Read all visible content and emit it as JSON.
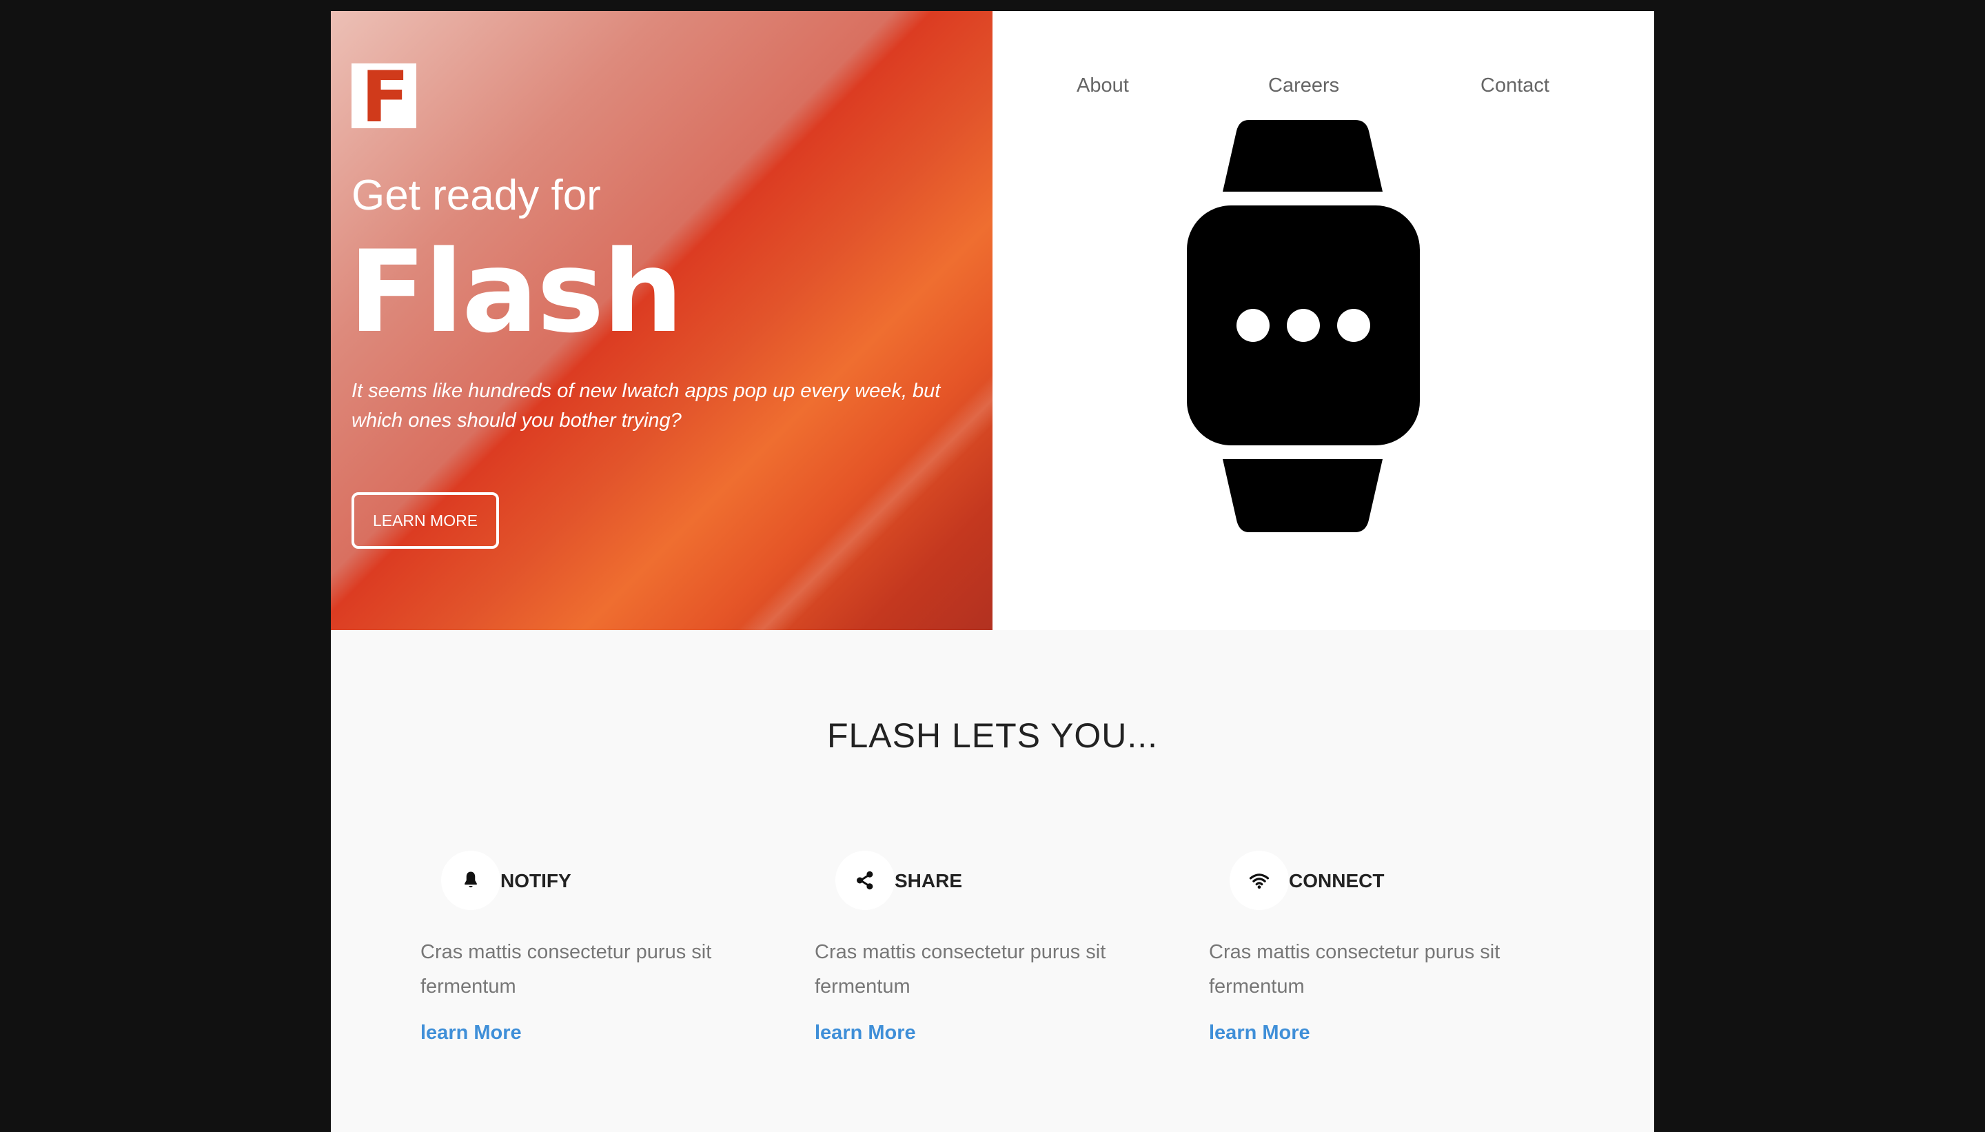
{
  "hero": {
    "logo_letter": "F",
    "pre_title": "Get ready for",
    "title": "Flash",
    "description": "It seems like hundreds of new Iwatch apps pop up every week, but which ones should you bother trying?",
    "cta_label": "LEARN MORE"
  },
  "nav": {
    "items": [
      {
        "label": "About"
      },
      {
        "label": "Careers"
      },
      {
        "label": "Contact"
      }
    ]
  },
  "features": {
    "title": "FLASH LETS YOU...",
    "items": [
      {
        "name": "NOTIFY",
        "icon": "bell-icon",
        "description": "Cras mattis consectetur purus sit fermentum",
        "link": "learn More"
      },
      {
        "name": "SHARE",
        "icon": "share-icon",
        "description": "Cras mattis consectetur purus sit fermentum",
        "link": "learn More"
      },
      {
        "name": "CONNECT",
        "icon": "wifi-icon",
        "description": "Cras mattis consectetur purus sit fermentum",
        "link": "learn More"
      }
    ]
  },
  "colors": {
    "brand": "#d03a1b",
    "accent_orange": "#ef6e30",
    "link": "#3f8fd8",
    "backdrop": "#111111"
  }
}
